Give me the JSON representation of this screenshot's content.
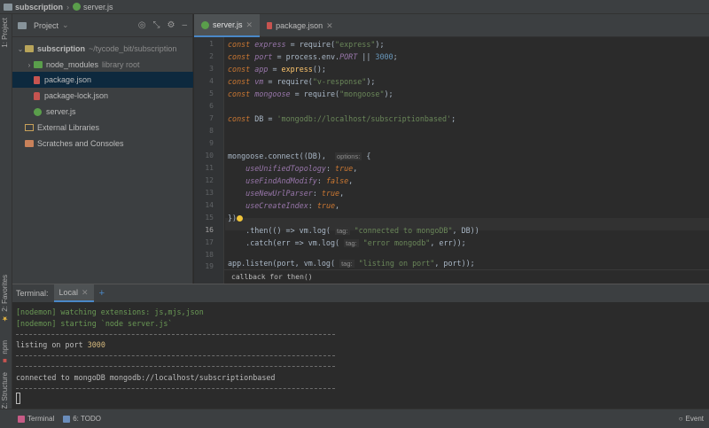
{
  "breadcrumb": {
    "project": "subscription",
    "file": "server.js"
  },
  "left_strip": {
    "project_tab": "1: Project",
    "favorites_tab": "2: Favorites",
    "npm_tab": "npm",
    "structure_tab": "Z: Structure"
  },
  "project_panel": {
    "title": "Project",
    "tree": [
      {
        "label": "subscription",
        "meta": "~/tycode_bit/subscription"
      },
      {
        "label": "node_modules",
        "meta": "library root"
      },
      {
        "label": "package.json"
      },
      {
        "label": "package-lock.json"
      },
      {
        "label": "server.js"
      },
      {
        "label": "External Libraries"
      },
      {
        "label": "Scratches and Consoles"
      }
    ]
  },
  "editor": {
    "tabs": [
      {
        "label": "server.js"
      },
      {
        "label": "package.json"
      }
    ],
    "line_numbers": [
      "1",
      "2",
      "3",
      "4",
      "5",
      "6",
      "7",
      "8",
      "9",
      "10",
      "11",
      "12",
      "13",
      "14",
      "15",
      "16",
      "17",
      "18",
      "19"
    ],
    "current_line": "16",
    "lines": {
      "l1_kw": "const",
      "l1_var": "express",
      "l1_mid": " = require(",
      "l1_str": "\"express\"",
      "l1_end": ");",
      "l2_kw": "const",
      "l2_var": "port",
      "l2_mid": " = process.env.",
      "l2_port": "PORT",
      "l2_or": " || ",
      "l2_num": "3000",
      "l2_end": ";",
      "l3_kw": "const",
      "l3_var": "app",
      "l3_mid": " = ",
      "l3_fn": "express",
      "l3_end": "();",
      "l4_kw": "const",
      "l4_var": "vm",
      "l4_mid": " = require(",
      "l4_str": "\"v-response\"",
      "l4_end": ");",
      "l5_kw": "const",
      "l5_var": "mongoose",
      "l5_mid": " = require(",
      "l5_str": "\"mongoose\"",
      "l5_end": ");",
      "l7_kw": "const",
      "l7_mid": " DB = ",
      "l7_str": "'mongodb://localhost/subscriptionbased'",
      "l7_end": ";",
      "l10_start": "mongoose.connect((DB),  ",
      "l10_hint": "options:",
      "l10_end": " {",
      "l11_var": "useUnifiedTopology",
      "l11_mid": ": ",
      "l11_kw": "true",
      "l11_end": ",",
      "l12_var": "useFindAndModify",
      "l12_mid": ": ",
      "l12_kw": "false",
      "l12_end": ",",
      "l13_var": "useNewUrlParser",
      "l13_mid": ": ",
      "l13_kw": "true",
      "l13_end": ",",
      "l14_var": "useCreateIndex",
      "l14_mid": ": ",
      "l14_kw": "true",
      "l14_end": ",",
      "l15_text": "})",
      "l16_start": "    .then(() => vm.log( ",
      "l16_hint": "tag:",
      "l16_str": "\"connected to mongoDB\"",
      "l16_end": ", DB))",
      "l17_start": "    .catch(err => vm.log( ",
      "l17_hint": "tag:",
      "l17_str": "\"error mongodb\"",
      "l17_end": ", err));",
      "l19_start": "app.listen(port, vm.log( ",
      "l19_hint": "tag:",
      "l19_str": "\"listing on port\"",
      "l19_end": ", port));"
    },
    "footer": "callback for then()"
  },
  "terminal": {
    "title": "Terminal:",
    "tab": "Local",
    "lines": {
      "l1": "[nodemon] watching extensions: js,mjs,json",
      "l2": "[nodemon] starting `node server.js`",
      "l3_text": "listing on port ",
      "l3_num": "3000",
      "l4": "connected to mongoDB mongodb://localhost/subscriptionbased"
    }
  },
  "bottom_bar": {
    "terminal": "Terminal",
    "todo": "6: TODO",
    "event_log": "Event"
  }
}
